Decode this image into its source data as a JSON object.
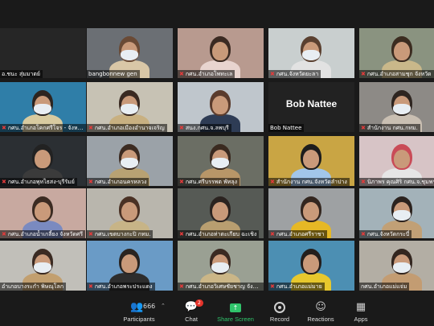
{
  "tiles": [
    {
      "name": "อ.ชนะ สุ่มมาตย์",
      "muted": false,
      "active": true,
      "type": "dark"
    },
    {
      "name": "bangbonnew gen",
      "muted": false,
      "type": "video",
      "bg": "#6b6f74",
      "head": "#6a4a35",
      "mask": true,
      "shirt": "#d9c7a7"
    },
    {
      "name": "กศน.อำเภอโพทะเล",
      "muted": true,
      "type": "video",
      "bg": "#b89a8f",
      "head": "#3b2a22",
      "mask": false,
      "shirt": "#e8d4cf"
    },
    {
      "name": "กศน.จังหวัดยะลา",
      "muted": true,
      "type": "video",
      "bg": "#c9cfcf",
      "head": "#5a4030",
      "mask": true,
      "shirt": "#e2e2e2"
    },
    {
      "name": "กศน.อำเภอสามชุก จังหวัด",
      "muted": true,
      "type": "video",
      "bg": "#8a9380",
      "head": "#3b2c20",
      "mask": false,
      "shirt": "#c9b88a"
    },
    {
      "name": "กศน.อำเภอโคกศรีโจร - จังหวัด",
      "muted": true,
      "type": "video",
      "bg": "#2f7ea8",
      "head": "#2c2420",
      "mask": true,
      "shirt": "#d8cba0"
    },
    {
      "name": "กศน.อำเภอเมืองอำนาจเจริญ",
      "muted": true,
      "type": "video",
      "bg": "#c7c2b4",
      "head": "#3a2a22",
      "mask": true,
      "shirt": "#c8b081"
    },
    {
      "name": "สนง.กศน.จ.ลพบุรี",
      "muted": true,
      "type": "video",
      "bg": "#bfc6cc",
      "head": "#5a3b2c",
      "mask": false,
      "shirt": "#2e3c55"
    },
    {
      "name": "Bob Nattee",
      "muted": false,
      "type": "label"
    },
    {
      "name": "สำนักงาน กศน.กทม.",
      "muted": true,
      "type": "video",
      "bg": "#8d8a86",
      "head": "#2e2520",
      "mask": true,
      "shirt": "#c9bfb2"
    },
    {
      "name": "กศน.อำเภอพุทไธสง-บุรีรัมย์",
      "muted": true,
      "type": "video",
      "bg": "#2b2f33",
      "head": "#222222",
      "mask": false,
      "shirt": "#3b3b3b"
    },
    {
      "name": "กศน.อำเภอนครหลวง",
      "muted": true,
      "type": "video",
      "bg": "#9ba2a8",
      "head": "#3c2b22",
      "mask": true,
      "shirt": "#b8a273"
    },
    {
      "name": "กศน.ศรีบรรพต พัทลุง",
      "muted": true,
      "type": "video",
      "bg": "#6b6e64",
      "head": "#3a2a20",
      "mask": true,
      "shirt": "#b89668"
    },
    {
      "name": "สำนักงาน กศน.จังหวัดลำปาง",
      "muted": true,
      "type": "video",
      "bg": "#c9a544",
      "head": "#1d1d1d",
      "mask": false,
      "shirt": "#a2c6ea"
    },
    {
      "name": "นิภาพร คุณศิริ กศน.จ.ชุมพร",
      "muted": true,
      "type": "video",
      "bg": "#d7c4c6",
      "head": "#c94b57",
      "mask": false,
      "shirt": "#e6e6e6"
    },
    {
      "name": "กศน.อำเภอน้ำเกลี้ยง จังหวัดศรี",
      "muted": true,
      "type": "video",
      "bg": "#c8a9a0",
      "head": "#3b2b22",
      "mask": false,
      "shirt": "#7a8ac0"
    },
    {
      "name": "กศน.เขตบางกะปิ กทม.",
      "muted": true,
      "type": "video",
      "bg": "#b9b6ad",
      "head": "#4a3124",
      "mask": false,
      "shirt": "#c7b487"
    },
    {
      "name": "กศน.อำเภอท่าตะเกียบ ฉะเชิง",
      "muted": true,
      "type": "video",
      "bg": "#565a55",
      "head": "#2b2320",
      "mask": false,
      "shirt": "#b89e70"
    },
    {
      "name": "กศน.อำเภอศรีราชา",
      "muted": true,
      "type": "video",
      "bg": "#9ea1a3",
      "head": "#33261f",
      "mask": false,
      "shirt": "#e6b825"
    },
    {
      "name": "กศน.จังหวัดกระบี่",
      "muted": true,
      "type": "video",
      "bg": "#a3b2b9",
      "head": "#2b221e",
      "mask": true,
      "shirt": "#c1a076"
    },
    {
      "name": "อำเภอบางระกำ พิษณุโลก",
      "muted": false,
      "type": "video",
      "bg": "#c1bfb9",
      "head": "#3a2a22",
      "mask": true,
      "shirt": "#c29f6f"
    },
    {
      "name": "กศน.อำเภอพระประแดง",
      "muted": true,
      "type": "video",
      "bg": "#6a9bc6",
      "head": "#2a2420",
      "mask": false,
      "shirt": "#2d2d2d"
    },
    {
      "name": "กศน.อำเภอวิเศษชัยชาญ จังหวัด",
      "muted": true,
      "type": "video",
      "bg": "#9aa093",
      "head": "#3a2a22",
      "mask": true,
      "shirt": "#cbb687"
    },
    {
      "name": "กศน.อำเภอแม่มาย",
      "muted": true,
      "type": "video",
      "bg": "#4c8fb3",
      "head": "#231e1c",
      "mask": false,
      "shirt": "#e7c82d"
    },
    {
      "name": "กศน.อำเภอแม่แจ่ม",
      "muted": false,
      "type": "video",
      "bg": "#b3aea4",
      "head": "#33261f",
      "mask": true,
      "shirt": "#c39c72"
    }
  ],
  "toolbar": {
    "participants": {
      "label": "Participants",
      "count": "666",
      "icon": "people-icon"
    },
    "chat": {
      "label": "Chat",
      "badge": "2",
      "icon": "chat-icon"
    },
    "share": {
      "label": "Share Screen",
      "icon": "share-screen-icon",
      "color": "#30c46b"
    },
    "record": {
      "label": "Record",
      "icon": "record-icon"
    },
    "reactions": {
      "label": "Reactions",
      "icon": "emoji-plus-icon"
    },
    "apps": {
      "label": "Apps",
      "icon": "apps-icon"
    }
  }
}
